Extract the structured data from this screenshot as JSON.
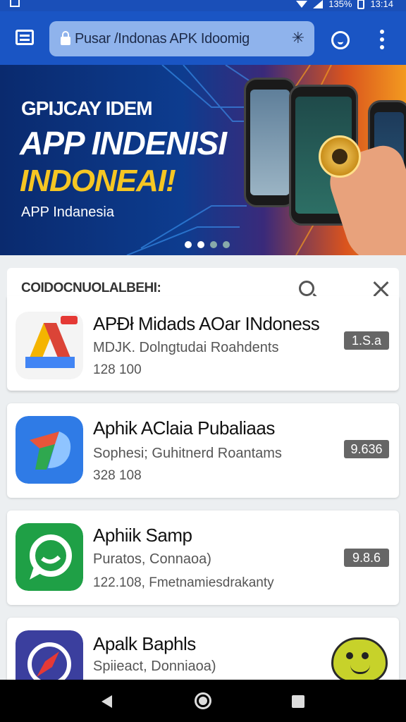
{
  "status_bar": {
    "battery": "135%",
    "time": "13:14"
  },
  "toolbar": {
    "url": "Pusar /Indonas APK Idoomig",
    "url_action_glyph": "✳"
  },
  "banner": {
    "eyebrow": "GPIJCAY IDEM",
    "title": "APP INDENISI",
    "highlight": "INDONEAI!",
    "caption": "APP Indanesia",
    "slides": 4,
    "active_slide": 1
  },
  "list": {
    "title": "COIDOCNUOLALBEHI:"
  },
  "apps": [
    {
      "name": "APÐł Midads AOar INdoness",
      "subtitle": "MDJK. Dolngtudai Roahdents",
      "meta": "128 100",
      "version": "1.S.a",
      "icon": "google-ads-style-icon"
    },
    {
      "name": "Aphik AClaia Pubaliaas",
      "subtitle": "Sophesi; Guhitnerd Roantams",
      "meta": "328 108",
      "version": "9.636",
      "icon": "blue-ribbon-icon"
    },
    {
      "name": "Aphiik Samp",
      "subtitle": "Puratos, Connaoa)",
      "meta": "122.108, Fmetnamiesdrakanty",
      "version": "9.8.6",
      "icon": "chat-bubble-icon"
    },
    {
      "name": "Apalk Baphls",
      "subtitle": "Spiieact, Donniaoa)",
      "meta": "",
      "version": "",
      "icon": "compass-icon"
    }
  ],
  "colors": {
    "toolbar": "#1a55c4",
    "url_field": "#8fb3ec",
    "banner_highlight": "#f6c623",
    "badge": "#666666"
  }
}
